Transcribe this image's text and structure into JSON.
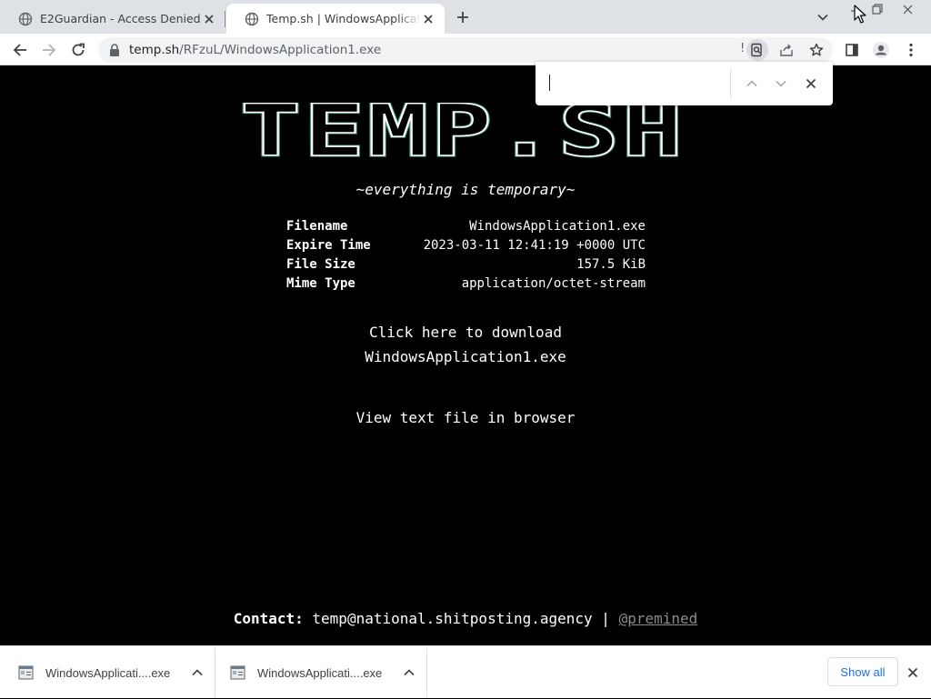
{
  "tabs": [
    {
      "title": "E2Guardian - Access Denied",
      "active": false
    },
    {
      "title": "Temp.sh | WindowsApplication1.exe",
      "active": true
    }
  ],
  "toolbar": {
    "url_host": "temp.sh",
    "url_path": "/RFzuL/WindowsApplication1.exe",
    "omnibox_flag": "!"
  },
  "find_bar": {
    "query": ""
  },
  "page": {
    "logo_text": "TEMP.SH",
    "tagline": "~everything is temporary~",
    "info": [
      {
        "key": "Filename",
        "value": "WindowsApplication1.exe"
      },
      {
        "key": "Expire Time",
        "value": "2023-03-11 12:41:19 +0000 UTC"
      },
      {
        "key": "File Size",
        "value": "157.5 KiB"
      },
      {
        "key": "Mime Type",
        "value": "application/octet-stream"
      }
    ],
    "download_line1": "Click here to download",
    "download_line2": "WindowsApplication1.exe",
    "view_text": "View text file in browser",
    "contact_label": "Contact:",
    "contact_email": "temp@national.shitposting.agency",
    "contact_sep": "|",
    "contact_handle": "@premined"
  },
  "download_shelf": {
    "items": [
      {
        "name": "WindowsApplicati....exe"
      },
      {
        "name": "WindowsApplicati....exe"
      }
    ],
    "show_all_label": "Show all"
  },
  "colors": {
    "page_bg": "#000000",
    "page_text": "#ffffff",
    "tabstrip_bg": "#dee1e6",
    "link_blue": "#1a73e8"
  },
  "icons": [
    "globe-icon",
    "close-icon",
    "plus-icon",
    "chevron-down-icon",
    "back-icon",
    "forward-icon",
    "reload-icon",
    "lock-icon",
    "lens-icon",
    "share-icon",
    "star-icon",
    "side-panel-icon",
    "profile-icon",
    "menu-icon",
    "chevron-up-icon",
    "file-icon",
    "chevron-up-icon"
  ]
}
